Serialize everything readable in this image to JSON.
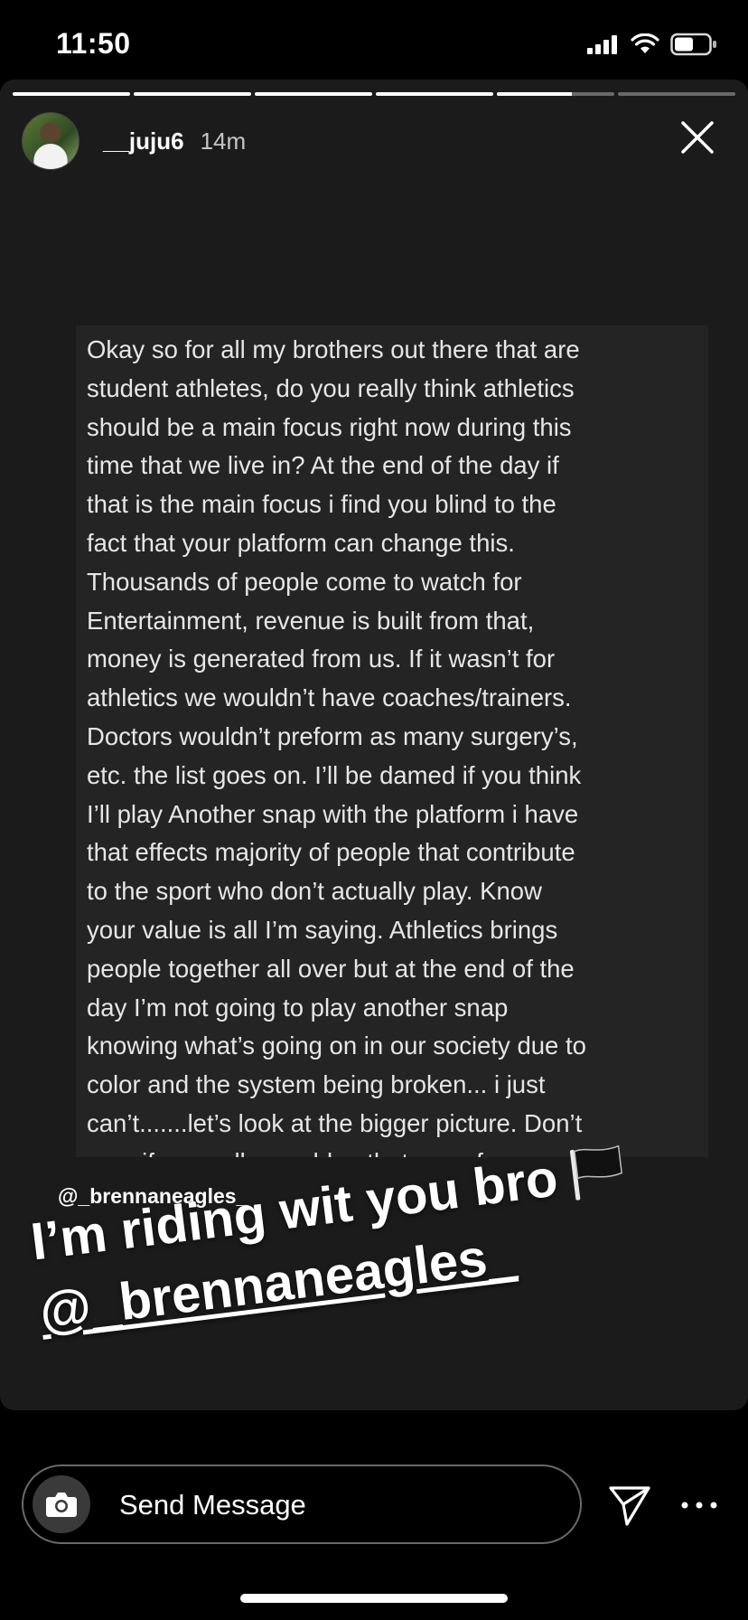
{
  "status_bar": {
    "time": "11:50",
    "icons": [
      "signal-icon",
      "wifi-icon",
      "battery-icon"
    ]
  },
  "story": {
    "progress_segments": [
      1,
      1,
      1,
      1,
      0.64,
      0
    ],
    "user": {
      "username": "__juju6",
      "time_ago": "14m"
    },
    "note_lines": [
      "Okay so for all my brothers out there that are",
      "student athletes, do you really think athletics",
      "should be a main focus right now during this",
      "time that we live in? At the end of the day if",
      "that is the main focus i find you blind to the",
      "fact that your platform can change this.",
      "Thousands of people come to watch for",
      "Entertainment,  revenue is built from that,",
      "money is generated from us. If it wasn’t for",
      "athletics we wouldn’t have coaches/trainers.",
      "Doctors wouldn’t preform as many surgery’s,",
      "etc. the list goes on. I’ll be damed if you think",
      "I’ll play Another snap with the platform i have",
      "that effects majority of people that contribute",
      "to the sport who don’t actually play. Know",
      "your value is all I’m saying. Athletics brings",
      "people together all over but at the end of the",
      "day I’m not going to play another snap",
      "knowing what’s going on in our society due to",
      "color and the system being broken... i just",
      "can’t.......let’s look at the bigger picture. Don’t",
      "care if you yellow or blue that goes for every"
    ],
    "mention_tag": "@_brennaneagles_",
    "caption_line1": "I’m riding wit you bro",
    "caption_mention": "@_brennaneagles_",
    "caption_flag_icon": "black-flag-icon"
  },
  "footer": {
    "message_placeholder": "Send Message",
    "camera_icon": "camera-icon",
    "send_icon": "paper-plane-icon",
    "more_icon": "more-icon"
  },
  "colors": {
    "background": "#000000",
    "card": "#1b1b1c",
    "note_panel": "#242425",
    "text": "#ffffff"
  }
}
